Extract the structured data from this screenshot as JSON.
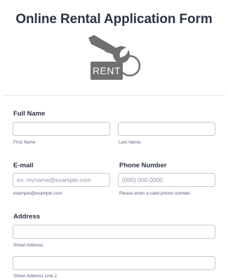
{
  "form": {
    "title": "Online Rental Application Form",
    "logo_text": "RENT",
    "logo_color": "#707070"
  },
  "full_name": {
    "label": "Full Name",
    "first_name": {
      "value": "",
      "sublabel": "First Name"
    },
    "last_name": {
      "value": "",
      "sublabel": "Last Name"
    }
  },
  "email": {
    "label": "E-mail",
    "placeholder": "ex: myname@example.com",
    "sublabel": "example@example.com"
  },
  "phone": {
    "label": "Phone Number",
    "placeholder": "(000) 000-0000",
    "sublabel": "Please enter a valid phone number."
  },
  "address": {
    "label": "Address",
    "street": {
      "value": "",
      "sublabel": "Street Address"
    },
    "street2": {
      "value": "",
      "sublabel": "Street Address Line 2"
    }
  }
}
